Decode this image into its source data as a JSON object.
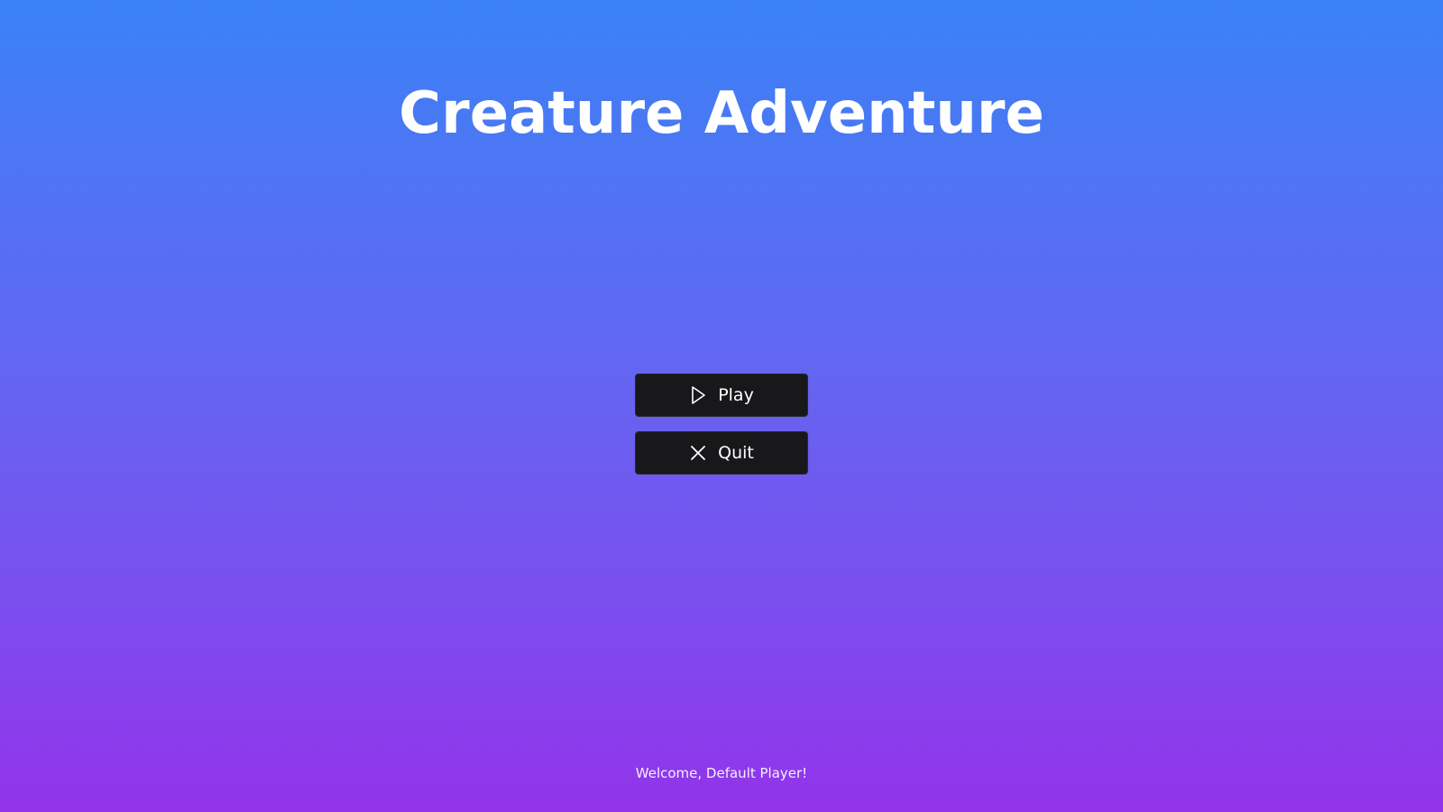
{
  "title": "Creature Adventure",
  "menu": {
    "play": {
      "label": "Play",
      "icon": "play-icon"
    },
    "quit": {
      "label": "Quit",
      "icon": "close-icon"
    }
  },
  "welcome_text": "Welcome, Default Player!",
  "colors": {
    "background_top": "#3b82f6",
    "background_bottom": "#9333ea",
    "button_bg": "#18181b",
    "text": "#ffffff"
  }
}
